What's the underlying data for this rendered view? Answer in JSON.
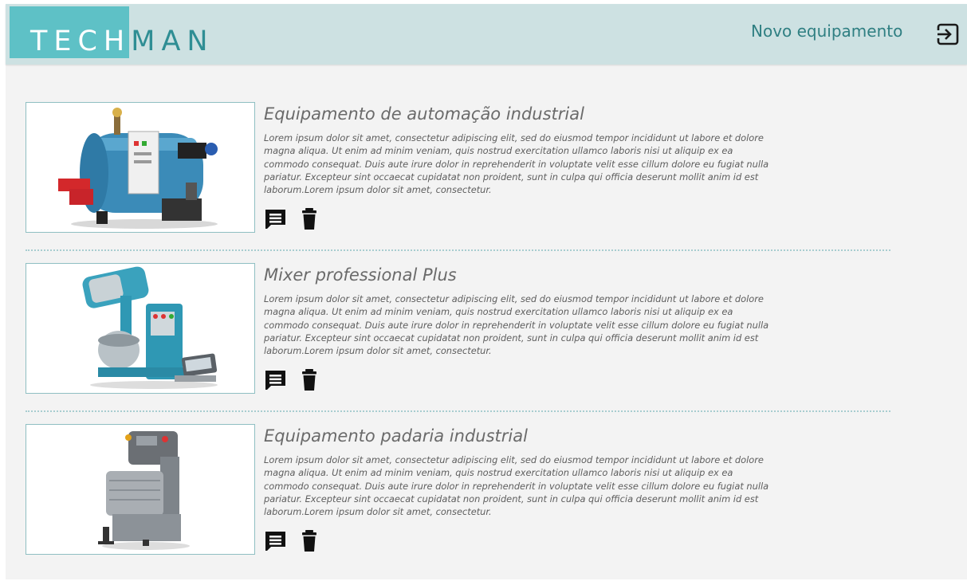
{
  "app": {
    "logo": {
      "part1": "TECH",
      "part2": "MAN"
    },
    "header": {
      "new_equipment_label": "Novo equipamento",
      "logout_icon": "logout-icon"
    },
    "colors": {
      "header_bg": "#cde1e2",
      "logo_block": "#5ec1c6",
      "accent": "#2f8e94"
    }
  },
  "equipment": [
    {
      "title": "Equipamento de automação industrial",
      "description": "Lorem ipsum dolor sit amet, consectetur adipiscing elit, sed do eiusmod tempor incididunt ut labore et dolore magna aliqua. Ut enim ad minim veniam, quis nostrud exercitation ullamco laboris nisi ut aliquip ex ea commodo consequat. Duis aute irure dolor in reprehenderit in voluptate velit esse cillum dolore eu fugiat nulla pariatur. Excepteur sint occaecat cupidatat non proident, sunt in culpa qui officia deserunt mollit anim id est laborum.Lorem ipsum dolor sit amet, consectetur.",
      "image_icon": "industrial-boiler-image",
      "comment_icon": "comment-icon",
      "delete_icon": "trash-icon"
    },
    {
      "title": "Mixer professional Plus",
      "description": "Lorem ipsum dolor sit amet, consectetur adipiscing elit, sed do eiusmod tempor incididunt ut labore et dolore magna aliqua. Ut enim ad minim veniam, quis nostrud exercitation ullamco laboris nisi ut aliquip ex ea commodo consequat. Duis aute irure dolor in reprehenderit in voluptate velit esse cillum dolore eu fugiat nulla pariatur. Excepteur sint occaecat cupidatat non proident, sunt in culpa qui officia deserunt mollit anim id est laborum.Lorem ipsum dolor sit amet, consectetur.",
      "image_icon": "mixer-image",
      "comment_icon": "comment-icon",
      "delete_icon": "trash-icon"
    },
    {
      "title": "Equipamento padaria industrial",
      "description": "Lorem ipsum dolor sit amet, consectetur adipiscing elit, sed do eiusmod tempor incididunt ut labore et dolore magna aliqua. Ut enim ad minim veniam, quis nostrud exercitation ullamco laboris nisi ut aliquip ex ea commodo consequat. Duis aute irure dolor in reprehenderit in voluptate velit esse cillum dolore eu fugiat nulla pariatur. Excepteur sint occaecat cupidatat non proident, sunt in culpa qui officia deserunt mollit anim id est laborum.Lorem ipsum dolor sit amet, consectetur.",
      "image_icon": "bakery-mixer-image",
      "comment_icon": "comment-icon",
      "delete_icon": "trash-icon"
    }
  ]
}
